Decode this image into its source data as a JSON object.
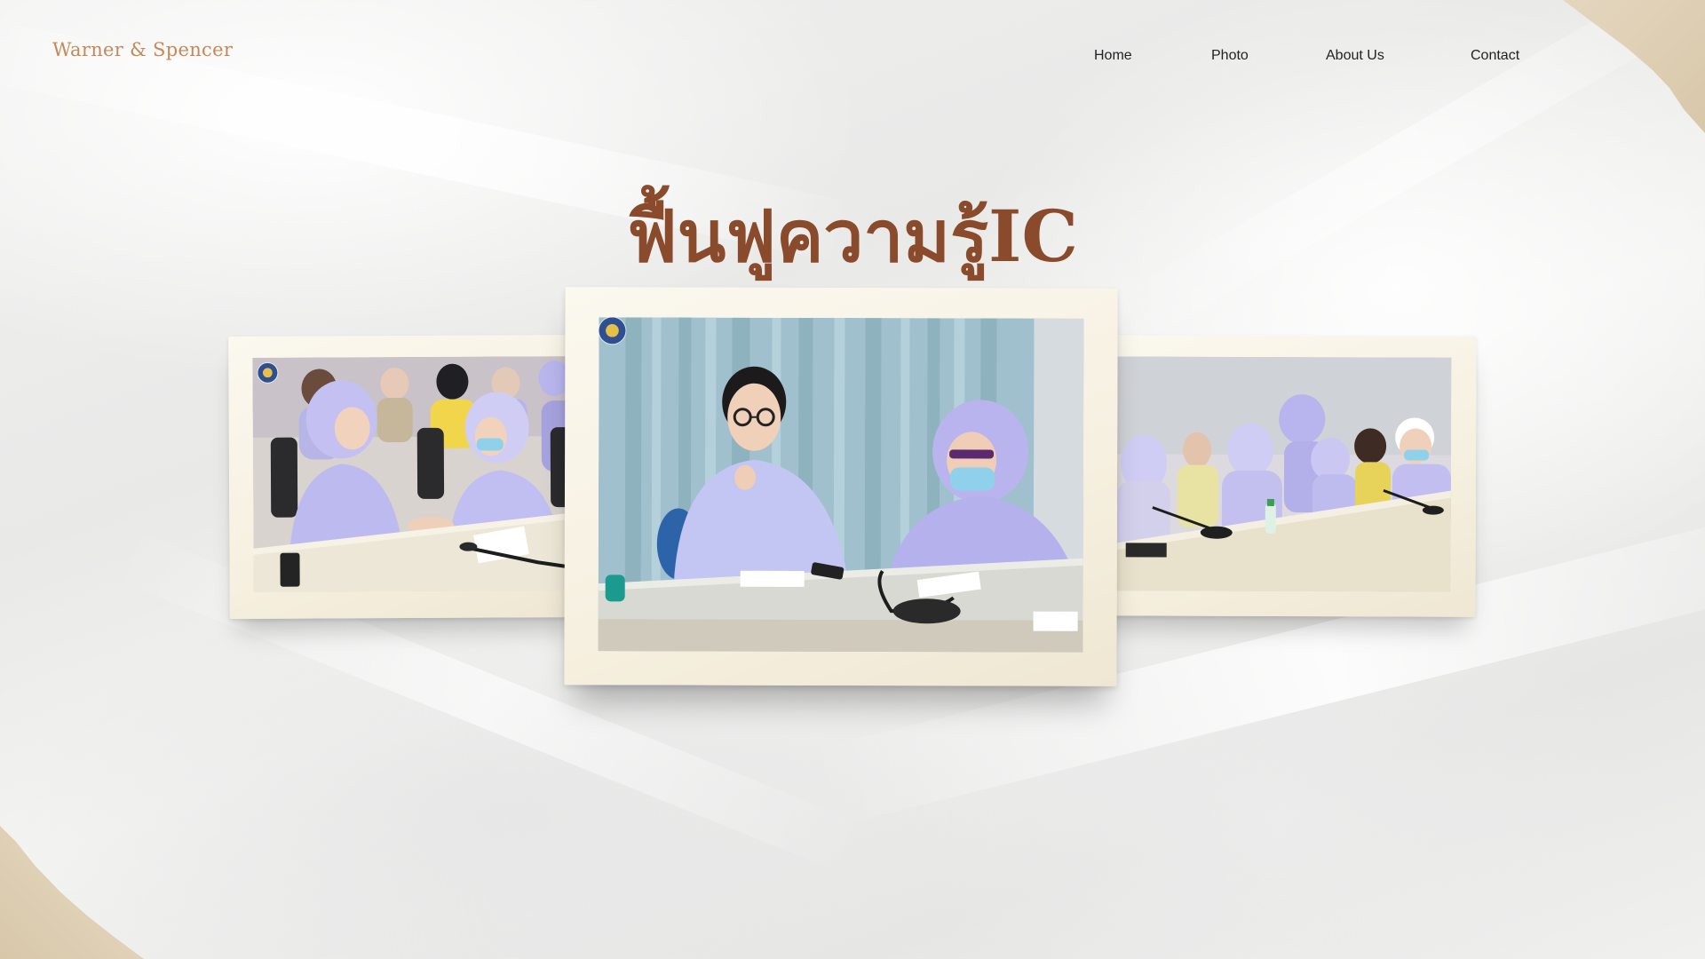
{
  "brand": {
    "name": "Warner & Spencer"
  },
  "nav": {
    "items": [
      {
        "label": "Home"
      },
      {
        "label": "Photo"
      },
      {
        "label": "About Us"
      },
      {
        "label": "Contact"
      }
    ]
  },
  "hero": {
    "title": "ฟื้นฟูความรู้IC"
  },
  "gallery": {
    "photos": [
      {
        "position": "left",
        "alt": ""
      },
      {
        "position": "center",
        "alt": ""
      },
      {
        "position": "right",
        "alt": ""
      }
    ]
  },
  "colors": {
    "brand": "#c4895a",
    "title": "#8a4a2c",
    "nav_text": "#222222",
    "frame": "#f6f0e0",
    "uniform": "#b9b6ee",
    "curtain": "#9fc0cc",
    "table": "#ece7d6"
  }
}
